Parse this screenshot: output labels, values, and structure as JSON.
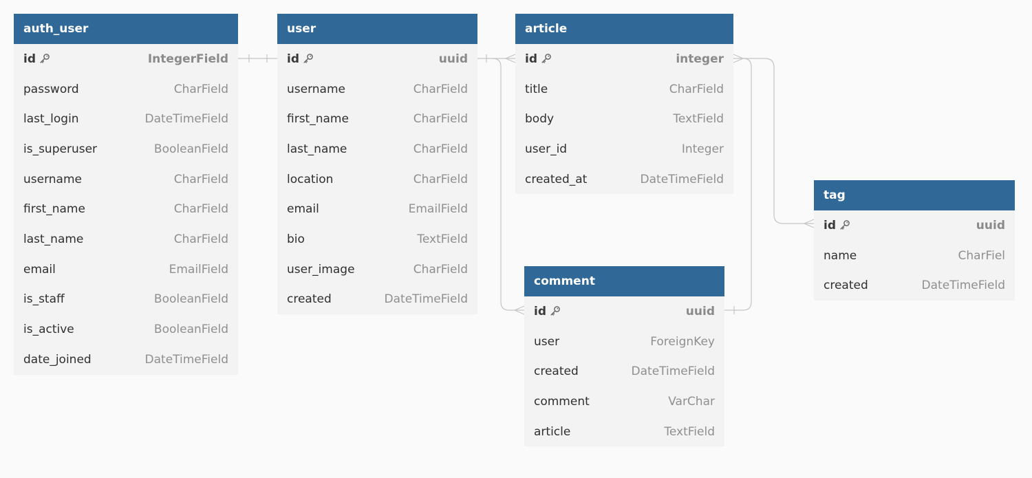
{
  "tables": [
    {
      "id": "auth_user",
      "name": "auth_user",
      "fields": [
        {
          "name": "id",
          "type": "IntegerField",
          "pk": true
        },
        {
          "name": "password",
          "type": "CharField"
        },
        {
          "name": "last_login",
          "type": "DateTimeField"
        },
        {
          "name": "is_superuser",
          "type": "BooleanField"
        },
        {
          "name": "username",
          "type": "CharField"
        },
        {
          "name": "first_name",
          "type": "CharField"
        },
        {
          "name": "last_name",
          "type": "CharField"
        },
        {
          "name": "email",
          "type": "EmailField"
        },
        {
          "name": "is_staff",
          "type": "BooleanField"
        },
        {
          "name": "is_active",
          "type": "BooleanField"
        },
        {
          "name": "date_joined",
          "type": "DateTimeField"
        }
      ]
    },
    {
      "id": "user",
      "name": "user",
      "fields": [
        {
          "name": "id",
          "type": "uuid",
          "pk": true
        },
        {
          "name": "username",
          "type": "CharField"
        },
        {
          "name": "first_name",
          "type": "CharField"
        },
        {
          "name": "last_name",
          "type": "CharField"
        },
        {
          "name": "location",
          "type": "CharField"
        },
        {
          "name": "email",
          "type": "EmailField"
        },
        {
          "name": "bio",
          "type": "TextField"
        },
        {
          "name": "user_image",
          "type": "CharField"
        },
        {
          "name": "created",
          "type": "DateTimeField"
        }
      ]
    },
    {
      "id": "article",
      "name": "article",
      "fields": [
        {
          "name": "id",
          "type": "integer",
          "pk": true
        },
        {
          "name": "title",
          "type": "CharField"
        },
        {
          "name": "body",
          "type": "TextField"
        },
        {
          "name": "user_id",
          "type": "Integer"
        },
        {
          "name": "created_at",
          "type": "DateTimeField"
        }
      ]
    },
    {
      "id": "comment",
      "name": "comment",
      "fields": [
        {
          "name": "id",
          "type": "uuid",
          "pk": true
        },
        {
          "name": "user",
          "type": "ForeignKey"
        },
        {
          "name": "created",
          "type": "DateTimeField"
        },
        {
          "name": "comment",
          "type": "VarChar"
        },
        {
          "name": "article",
          "type": "TextField"
        }
      ]
    },
    {
      "id": "tag",
      "name": "tag",
      "fields": [
        {
          "name": "id",
          "type": "uuid",
          "pk": true
        },
        {
          "name": "name",
          "type": "CharFiel"
        },
        {
          "name": "created",
          "type": "DateTimeField"
        }
      ]
    }
  ],
  "relationships": [
    {
      "from": "auth_user.id",
      "to": "user.id",
      "cardinality": "one-to-one"
    },
    {
      "from": "user.id",
      "to": "article.id",
      "cardinality": "one-to-many"
    },
    {
      "from": "user.id",
      "to": "comment.id",
      "cardinality": "one-to-many"
    },
    {
      "from": "article.id",
      "to": "comment.id",
      "cardinality": "many-to-one"
    },
    {
      "from": "article.id",
      "to": "tag.id",
      "cardinality": "many-to-many"
    }
  ],
  "colors": {
    "header_bg": "#306897",
    "header_text": "#ffffff",
    "body_bg": "#f3f3f3",
    "canvas_bg": "#fafafa",
    "field_name": "#2f2f2f",
    "field_type": "#8f8f8f",
    "connector": "#c4c4c4"
  },
  "icons": {
    "primary_key": "key-icon"
  }
}
